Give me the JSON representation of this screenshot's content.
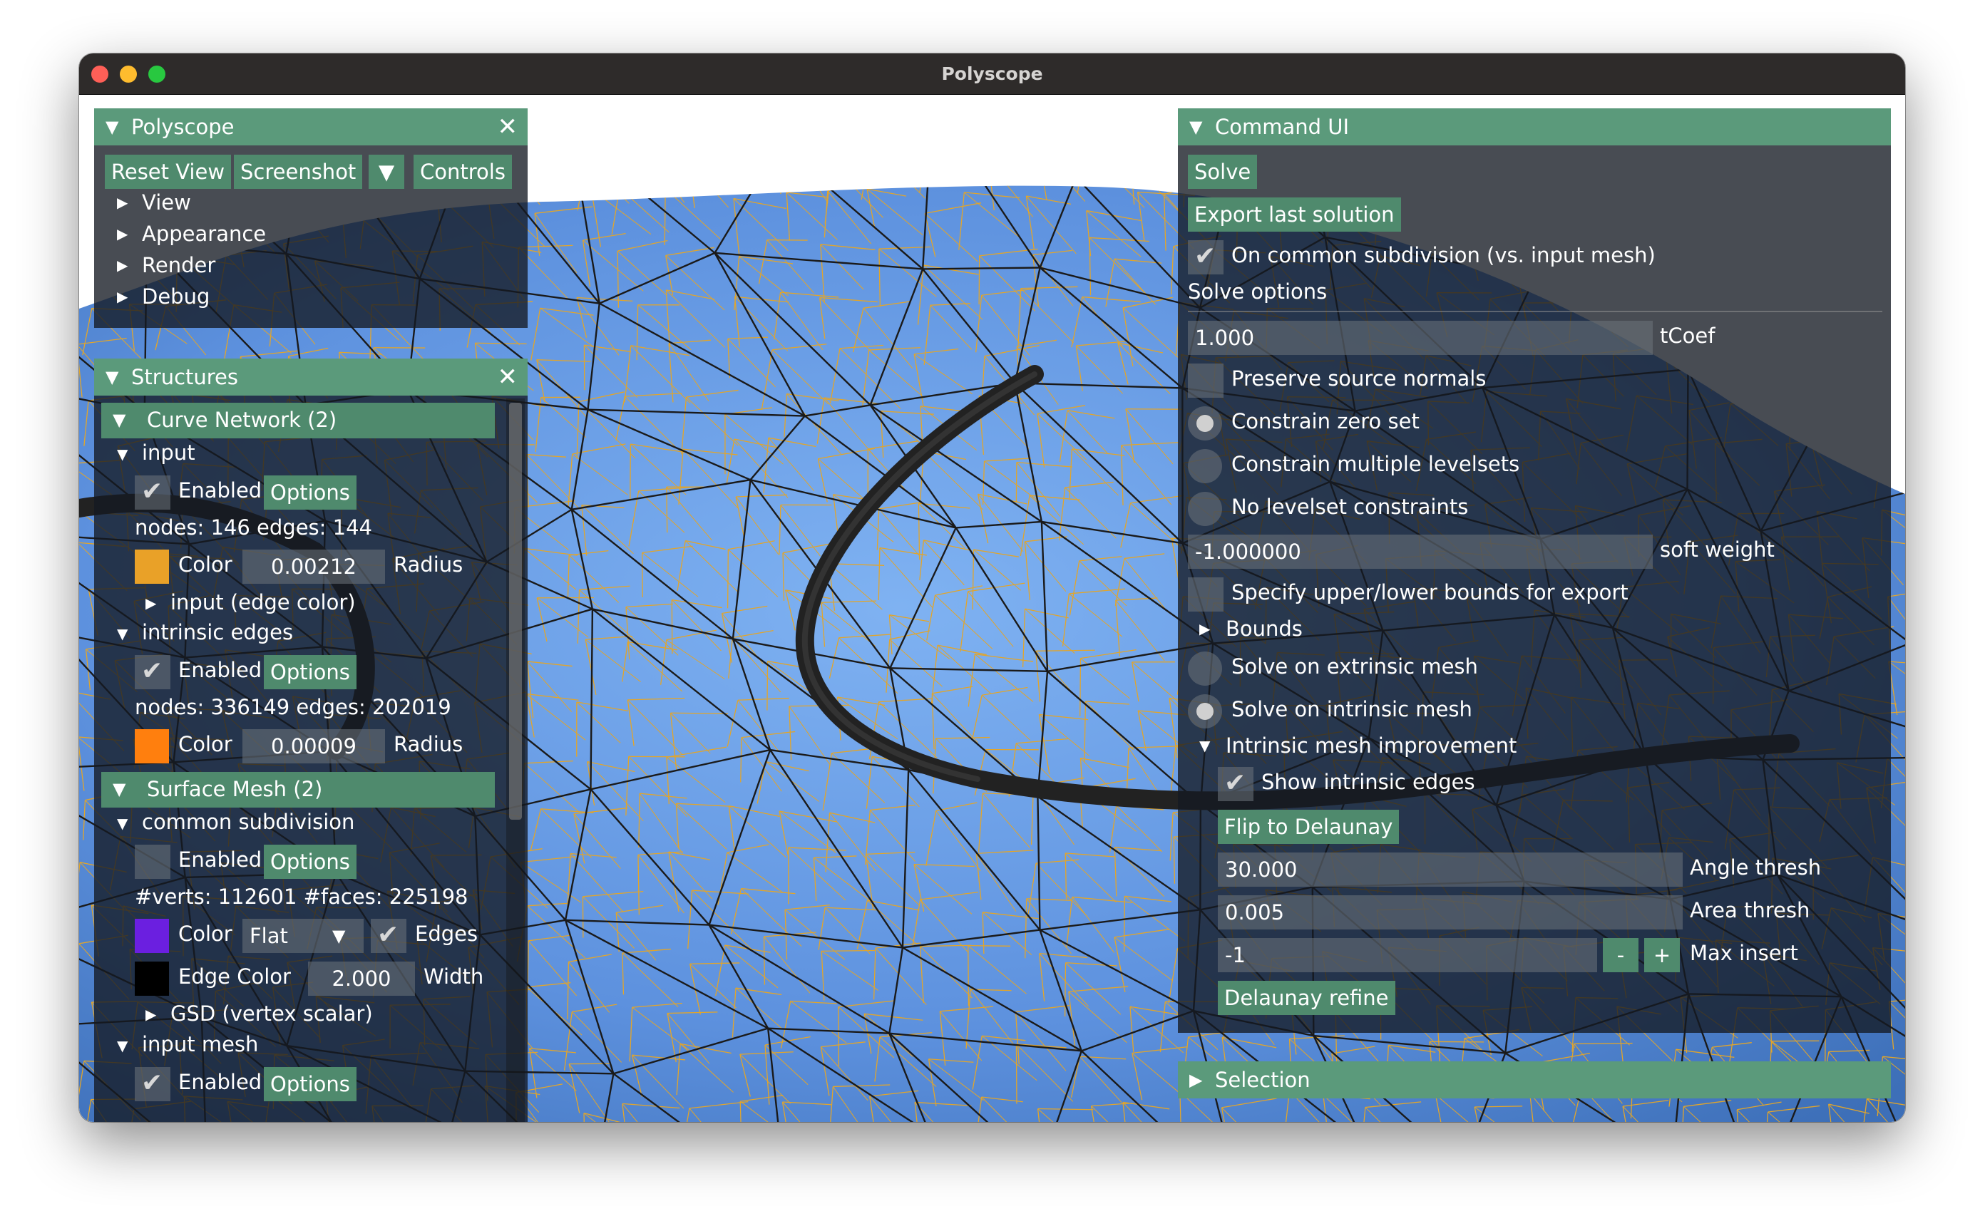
{
  "window": {
    "title": "Polyscope"
  },
  "polyscope_panel": {
    "title": "Polyscope",
    "buttons": {
      "reset_view": "Reset View",
      "screenshot": "Screenshot",
      "controls": "Controls"
    },
    "tree": [
      "View",
      "Appearance",
      "Render",
      "Debug"
    ]
  },
  "structures_panel": {
    "title": "Structures",
    "curve_network": {
      "header": "Curve Network (2)",
      "input": {
        "name": "input",
        "enabled_label": "Enabled",
        "options_label": "Options",
        "stats": "nodes: 146  edges: 144",
        "color_label": "Color",
        "color": "#e9a128",
        "radius_value": "0.00212",
        "radius_label": "Radius",
        "sub": "input (edge color)"
      },
      "intrinsic": {
        "name": "intrinsic edges",
        "enabled_label": "Enabled",
        "options_label": "Options",
        "stats": "nodes: 336149  edges: 202019",
        "color_label": "Color",
        "color": "#ff7f0e",
        "radius_value": "0.00009",
        "radius_label": "Radius"
      }
    },
    "surface_mesh": {
      "header": "Surface Mesh (2)",
      "common": {
        "name": "common subdivision",
        "enabled_label": "Enabled",
        "options_label": "Options",
        "stats": "#verts: 112601  #faces: 225198",
        "color_label": "Color",
        "color": "#6b1fe0",
        "shade": "Flat",
        "edges_label": "Edges",
        "edge_color_label": "Edge Color",
        "edge_color": "#000000",
        "width_value": "2.000",
        "width_label": "Width",
        "sub": "GSD (vertex scalar)"
      },
      "input_mesh": {
        "name": "input mesh",
        "enabled_label": "Enabled",
        "options_label": "Options"
      }
    }
  },
  "command_panel": {
    "title": "Command UI",
    "solve": "Solve",
    "export": "Export last solution",
    "on_common": "On common subdivision (vs. input mesh)",
    "solve_options": "Solve options",
    "tcoef_value": "1.000",
    "tcoef_label": "tCoef",
    "preserve": "Preserve source normals",
    "constrain_zero": "Constrain zero set",
    "constrain_multi": "Constrain multiple levelsets",
    "no_levelset": "No levelset constraints",
    "soft_value": "-1.000000",
    "soft_label": "soft weight",
    "specify_bounds": "Specify upper/lower bounds for export",
    "bounds": "Bounds",
    "solve_extrinsic": "Solve on extrinsic mesh",
    "solve_intrinsic": "Solve on intrinsic mesh",
    "intrinsic_improve": "Intrinsic mesh improvement",
    "show_intrinsic": "Show intrinsic edges",
    "flip": "Flip to Delaunay",
    "angle_value": "30.000",
    "angle_label": "Angle thresh",
    "area_value": "0.005",
    "area_label": "Area thresh",
    "max_value": "-1",
    "minus": "-",
    "plus": "+",
    "max_label": "Max insert",
    "refine": "Delaunay refine"
  },
  "selection_panel": {
    "title": "Selection"
  },
  "icons": {
    "expanded": "▼",
    "collapsed": "▶",
    "close": "✕",
    "check": "✔"
  },
  "colors": {
    "accent": "#5b9a7b",
    "button": "#4f8a6d",
    "mesh": "#5d91de",
    "wire": "#e2a52a",
    "curve": "#222222"
  }
}
